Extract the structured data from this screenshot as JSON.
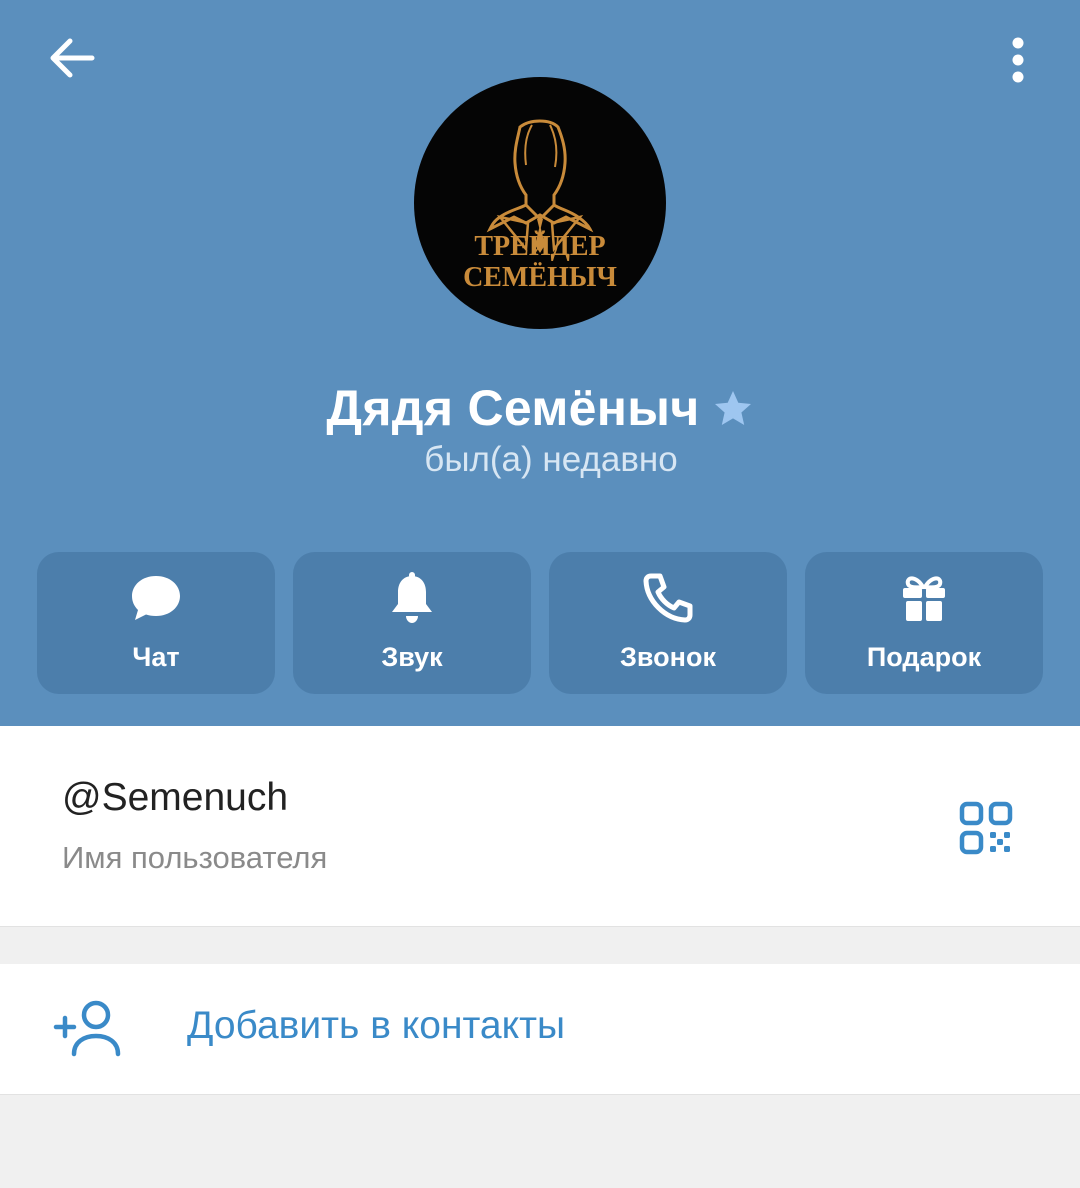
{
  "colors": {
    "header_bg": "#5b8fbd",
    "action_bg": "#4c7eab",
    "accent": "#3a8ac8",
    "premium_star": "#9ec6f0",
    "avatar_gold": "#c98b3a"
  },
  "profile": {
    "name": "Дядя Семёныч",
    "status": "был(а) недавно",
    "avatar_text_line1": "ТРЕЙДЕР",
    "avatar_text_line2": "СЕМЁНЫЧ",
    "premium_icon": "premium-star-icon"
  },
  "actions": [
    {
      "label": "Чат",
      "icon": "chat-bubble-icon"
    },
    {
      "label": "Звук",
      "icon": "bell-icon"
    },
    {
      "label": "Звонок",
      "icon": "phone-icon"
    },
    {
      "label": "Подарок",
      "icon": "gift-icon"
    }
  ],
  "info": {
    "username": "@Semenuch",
    "username_label": "Имя пользователя",
    "qr_icon": "qr-code-icon"
  },
  "add_contact": {
    "label": "Добавить в контакты",
    "icon": "add-person-icon"
  },
  "toolbar": {
    "back_icon": "arrow-left-icon",
    "more_icon": "more-vertical-icon"
  }
}
